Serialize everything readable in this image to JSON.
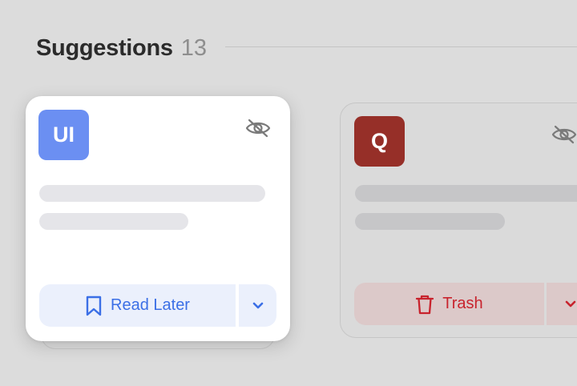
{
  "section": {
    "title": "Suggestions",
    "count": "13"
  },
  "cards": [
    {
      "avatar_text": "UI",
      "avatar_color": "#6b8ff2",
      "action_label": "Read Later",
      "action_icon": "bookmark-icon",
      "accent_color": "#3b6fe6"
    },
    {
      "avatar_text": "Q",
      "avatar_color": "#962f28",
      "action_label": "Trash",
      "action_icon": "trash-icon",
      "accent_color": "#c8232d"
    }
  ],
  "icons": {
    "hide": "eye-off-icon",
    "dropdown": "chevron-down-icon"
  }
}
